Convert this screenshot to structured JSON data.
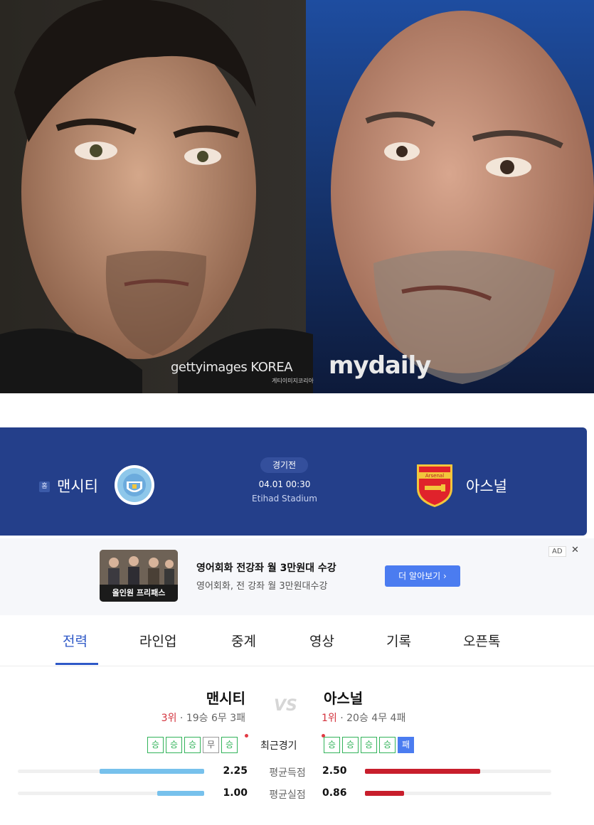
{
  "photo": {
    "watermark_getty": "gettyimages KOREA",
    "watermark_getty_sub": "게티이미지코리아",
    "watermark_mydaily": "mydaily"
  },
  "match": {
    "home_badge": "홈",
    "home_team": "맨시티",
    "away_team": "아스널",
    "status": "경기전",
    "datetime": "04.01 00:30",
    "stadium": "Etihad Stadium",
    "away_logo_text": "Arsenal"
  },
  "ad": {
    "tag": "AD",
    "close": "✕",
    "thumb_label": "올인원 프리패스",
    "title": "영어회화 전강좌 월 3만원대 수강",
    "description": "영어회화, 전 강좌 월 3만원대수강",
    "button": "더 알아보기 ›"
  },
  "tabs": [
    "전력",
    "라인업",
    "중계",
    "영상",
    "기록",
    "오픈톡"
  ],
  "active_tab": 0,
  "comparison": {
    "home_name": "맨시티",
    "away_name": "아스널",
    "vs": "VS",
    "home_rank": "3위",
    "home_record": "· 19승 6무 3패",
    "away_rank": "1위",
    "away_record": "· 20승 4무 4패",
    "recent_label": "최근경기",
    "home_form": [
      "승",
      "승",
      "승",
      "무",
      "승"
    ],
    "away_form": [
      "승",
      "승",
      "승",
      "승",
      "패"
    ],
    "stats": [
      {
        "label": "평균득점",
        "home": "2.25",
        "away": "2.50",
        "home_fraction": 0.56,
        "away_fraction": 0.62
      },
      {
        "label": "평균실점",
        "home": "1.00",
        "away": "0.86",
        "home_fraction": 0.25,
        "away_fraction": 0.21
      }
    ]
  },
  "colors": {
    "scoreboard_bg": "#243f8a",
    "active_tab": "#2e58c7",
    "win": "#32b35a",
    "loss": "#4b7cf0",
    "home_bar": "#77c1ec",
    "away_bar": "#c81e2c",
    "rank": "#d3323c"
  }
}
